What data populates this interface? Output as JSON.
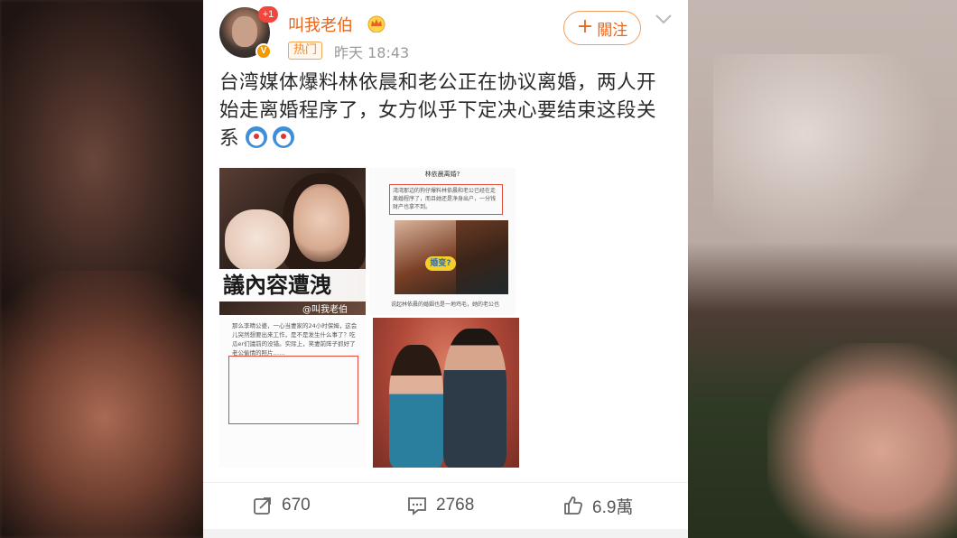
{
  "post": {
    "username": "叫我老伯",
    "notification_count": "+1",
    "verified_badge": "V",
    "hot_tag": "热门",
    "time": "昨天 18:43",
    "follow_label": "關注",
    "text": "台湾媒体爆料林依晨和老公正在协议离婚，两人开始走离婚程序了，女方似乎下定决心要结束这段关系"
  },
  "images": {
    "img1_caption": "議內容遭洩",
    "img1_watermark": "@叫我老伯",
    "img2_title": "林依晨离婚?",
    "img2_box_text": "湾湾那边的狗仔爆料林依晨和老公已经在走离婚程序了，而且她还是净身出户，一分钱财产也拿不到。",
    "img2_sticker": "婚变?",
    "img2_footer": "说起林依晨的婚姻也是一地鸡毛，她的老公也",
    "img3_text": "那么李晴公婆，一心当妻家的24小时保姆，这会儿突然想要出来工作，是不是发生什么事了？吃瓜er们議前的没错。实际上，笑妻前阵子抓好了老公偷情的照片……"
  },
  "actions": {
    "repost_count": "670",
    "comment_count": "2768",
    "like_count": "6.9萬"
  },
  "icons": {
    "crown": "crown-icon",
    "chevron": "chevron-down-icon",
    "repost": "share-icon",
    "comment": "comment-icon",
    "like": "thumbs-up-icon"
  },
  "colors": {
    "username": "#e8651a",
    "follow_border": "#f0a060",
    "hot_tag": "#f08a2a",
    "badge": "#f2453d"
  }
}
